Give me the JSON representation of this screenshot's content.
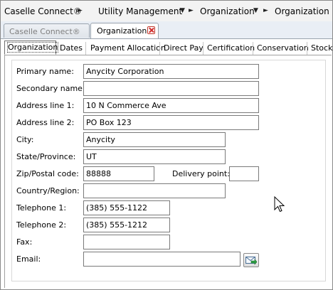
{
  "breadcrumb": {
    "items": [
      "Caselle Connect®",
      "Utility Management",
      "Organization",
      "Organization"
    ]
  },
  "doc_tabs": [
    {
      "label": "Caselle Connect®",
      "active": false
    },
    {
      "label": "Organization",
      "active": true
    }
  ],
  "sub_tabs": [
    {
      "label": "Organization",
      "active": true
    },
    {
      "label": "Dates"
    },
    {
      "label": "Payment Allocation"
    },
    {
      "label": "Direct Pay"
    },
    {
      "label": "Certification"
    },
    {
      "label": "Conservation"
    },
    {
      "label": "Stock"
    }
  ],
  "form": {
    "primary_name": {
      "label": "Primary name:",
      "value": "Anycity Corporation"
    },
    "secondary_name": {
      "label": "Secondary name:",
      "value": ""
    },
    "address_line_1": {
      "label": "Address line 1:",
      "value": "10 N Commerce Ave"
    },
    "address_line_2": {
      "label": "Address line 2:",
      "value": "PO Box 123"
    },
    "city": {
      "label": "City:",
      "value": "Anycity"
    },
    "state": {
      "label": "State/Province:",
      "value": "UT"
    },
    "zip": {
      "label": "Zip/Postal code:",
      "value": "88888"
    },
    "delivery_point": {
      "label": "Delivery point:",
      "value": ""
    },
    "country": {
      "label": "Country/Region:",
      "value": ""
    },
    "telephone_1": {
      "label": "Telephone 1:",
      "value": "(385) 555-1122"
    },
    "telephone_2": {
      "label": "Telephone 2:",
      "value": "(385) 555-1212"
    },
    "fax": {
      "label": "Fax:",
      "value": ""
    },
    "email": {
      "label": "Email:",
      "value": ""
    }
  },
  "icons": {
    "breadcrumb_arrow": "triangle-right",
    "breadcrumb_dropdown": "triangle-down",
    "tab_close": "close-icon",
    "email_button": "send-email-icon"
  },
  "colors": {
    "tab_close_red": "#d32f2f",
    "border": "#7a7a7a"
  }
}
